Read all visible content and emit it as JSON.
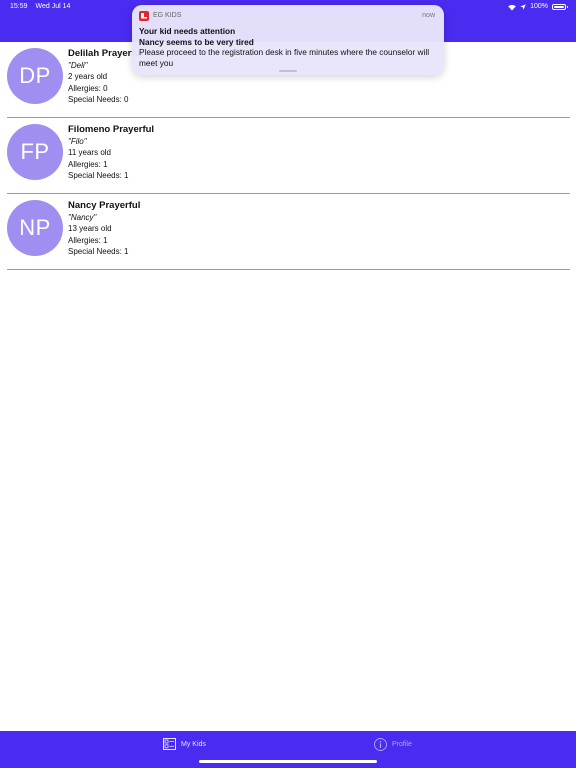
{
  "status_bar": {
    "time": "15:59",
    "date": "Wed Jul 14",
    "battery": "100%"
  },
  "kids": [
    {
      "initials": "DP",
      "name": "Delilah Prayerful",
      "nickname": "\"Deli\"",
      "age": "2 years old",
      "allergies": "Allergies: 0",
      "special_needs": "Special Needs: 0"
    },
    {
      "initials": "FP",
      "name": "Filomeno Prayerful",
      "nickname": "\"Filo\"",
      "age": "11 years old",
      "allergies": "Allergies: 1",
      "special_needs": "Special Needs: 1"
    },
    {
      "initials": "NP",
      "name": "Nancy Prayerful",
      "nickname": "\"Nancy\"",
      "age": "13 years old",
      "allergies": "Allergies: 1",
      "special_needs": "Special Needs: 1"
    }
  ],
  "notification": {
    "app_name": "EG KIDS",
    "time": "now",
    "title": "Your kid needs attention",
    "subtitle": "Nancy seems to be very tired",
    "body": "Please proceed to the registration desk in five minutes where the counselor will meet you"
  },
  "tabs": {
    "my_kids": "My Kids",
    "profile": "Profile"
  },
  "colors": {
    "brand": "#4a2bf0",
    "avatar": "#a08ef0"
  }
}
